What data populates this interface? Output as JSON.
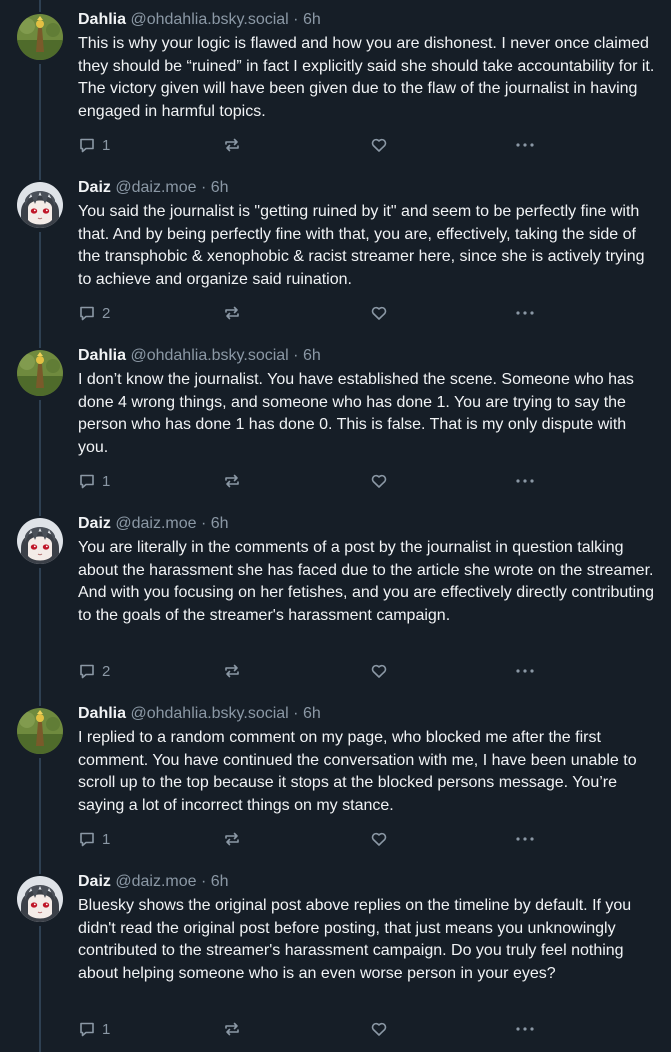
{
  "posts": [
    {
      "author": "Dahlia",
      "handle": "@ohdahlia.bsky.social",
      "separator": "·",
      "time": "6h",
      "avatar_icon": "grass-figure-avatar",
      "text": "This is why your logic is flawed and how you are dishonest. I never once claimed they should be “ruined” in fact I explicitly said she should take accountability for it. The victory given will have been given due to the flaw of the journalist in having engaged in harmful topics.",
      "reply_count": "1"
    },
    {
      "author": "Daiz",
      "handle": "@daiz.moe",
      "separator": "·",
      "time": "6h",
      "avatar_icon": "anime-character-avatar",
      "text": "You said the journalist is \"getting ruined by it\" and seem to be perfectly fine with that. And by being perfectly fine with that, you are, effectively, taking the side of the transphobic & xenophobic & racist streamer here, since she is actively trying to achieve and organize said ruination.",
      "reply_count": "2"
    },
    {
      "author": "Dahlia",
      "handle": "@ohdahlia.bsky.social",
      "separator": "·",
      "time": "6h",
      "avatar_icon": "grass-figure-avatar",
      "text": "I don’t know the journalist. You have established the scene. Someone who has done 4 wrong things, and someone who has done 1. You are trying to say the person who has done 1 has done 0. This is false. That is my only dispute with you.",
      "reply_count": "1"
    },
    {
      "author": "Daiz",
      "handle": "@daiz.moe",
      "separator": "·",
      "time": "6h",
      "avatar_icon": "anime-character-avatar",
      "text": "You are literally in the comments of a post by the journalist in question talking about the harassment she has faced due to the article she wrote on the streamer. And with you focusing on her fetishes, and you are effectively directly contributing to the goals of the streamer's harassment campaign.",
      "reply_count": "2"
    },
    {
      "author": "Dahlia",
      "handle": "@ohdahlia.bsky.social",
      "separator": "·",
      "time": "6h",
      "avatar_icon": "grass-figure-avatar",
      "text": "I replied to a random comment on my page, who blocked me after the first comment. You have continued the conversation with me, I have been unable to scroll up to the top because it stops at the blocked persons message. You’re saying a lot of incorrect things on my stance.",
      "reply_count": "1"
    },
    {
      "author": "Daiz",
      "handle": "@daiz.moe",
      "separator": "·",
      "time": "6h",
      "avatar_icon": "anime-character-avatar",
      "text": "Bluesky shows the original post above replies on the timeline by default. If you didn't read the original post before posting, that just means you unknowingly contributed to the streamer's harassment campaign. Do you truly feel nothing about helping someone who is an even worse person in your eyes?",
      "reply_count": "1"
    }
  ],
  "icons": {
    "reply": "reply-bubble-icon",
    "repost": "repost-arrows-icon",
    "like": "heart-icon",
    "more": "more-dots-icon"
  },
  "colors": {
    "background": "#161e27",
    "text": "#f1f3f5",
    "muted": "#8b98a5",
    "thread_line": "#2e4052"
  }
}
